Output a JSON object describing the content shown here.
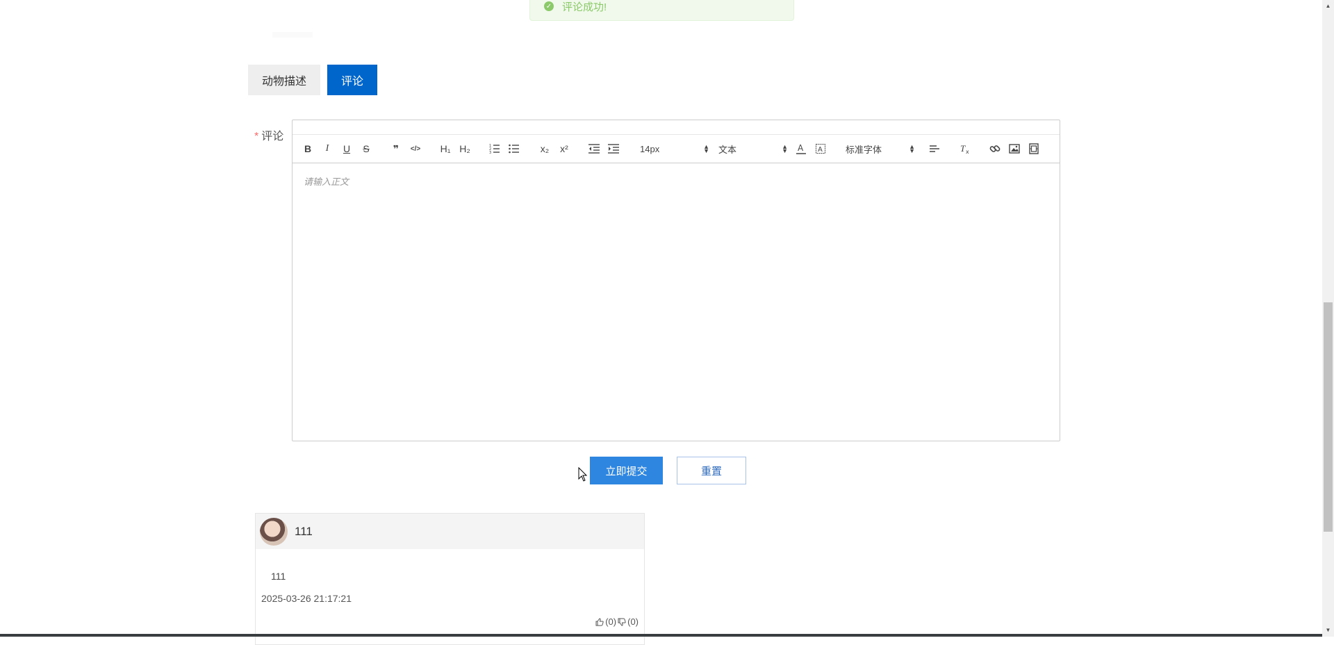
{
  "toast": {
    "message": "评论成功!"
  },
  "tabs": [
    {
      "label": "动物描述",
      "active": false
    },
    {
      "label": "评论",
      "active": true
    }
  ],
  "form": {
    "required_mark": "*",
    "label": "评论"
  },
  "editor": {
    "toolbar": {
      "bold": "B",
      "italic": "I",
      "underline": "U",
      "strike": "S",
      "blockquote": "❞",
      "code": "</>",
      "h1": "H₁",
      "h2": "H₂",
      "subscript": "x₂",
      "superscript": "x²",
      "font_size": "14px",
      "header_select": "文本",
      "font_family": "标准字体"
    },
    "placeholder": "请输入正文"
  },
  "actions": {
    "submit_label": "立即提交",
    "reset_label": "重置"
  },
  "comments": [
    {
      "username": "111",
      "content": "111",
      "time": "2025-03-26 21:17:21",
      "likes": "(0)",
      "dislikes": "(0)"
    }
  ],
  "colors": {
    "primary": "#0066cc",
    "submit": "#2f86e0",
    "success": "#8bc96a",
    "required": "#f56c6c"
  }
}
